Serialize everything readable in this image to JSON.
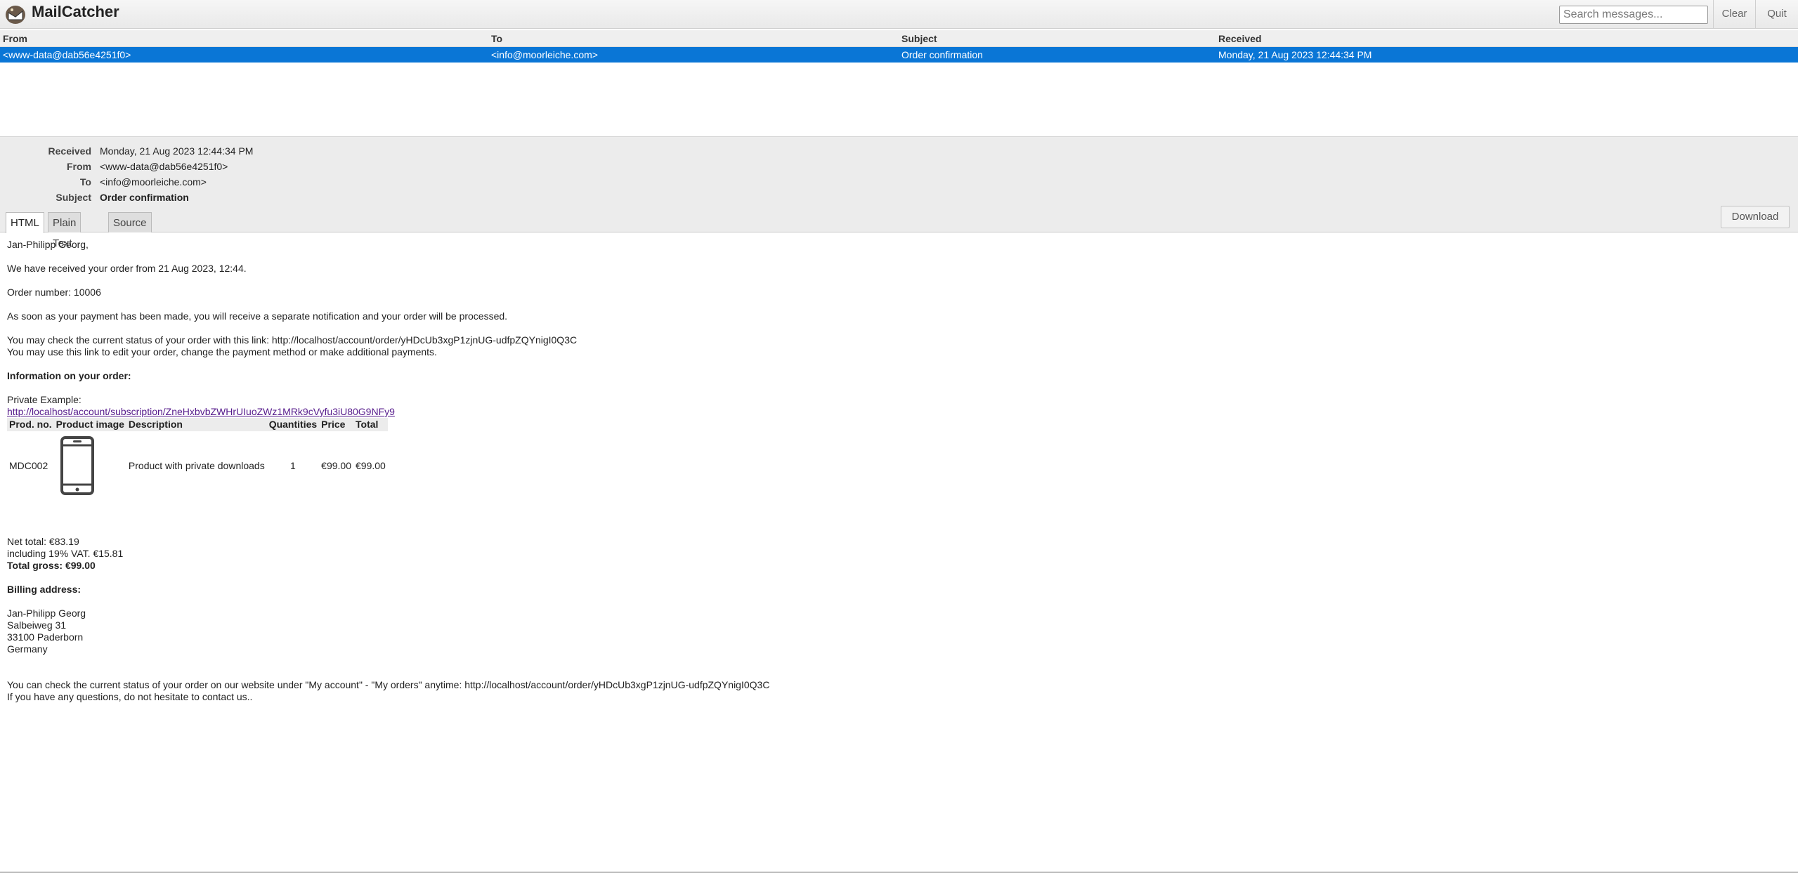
{
  "app": {
    "title": "MailCatcher",
    "search_placeholder": "Search messages...",
    "clear_label": "Clear",
    "quit_label": "Quit"
  },
  "list": {
    "columns": [
      "From",
      "To",
      "Subject",
      "Received"
    ],
    "messages": [
      {
        "from": "<www-data@dab56e4251f0>",
        "to": "<info@moorleiche.com>",
        "subject": "Order confirmation",
        "received": "Monday, 21 Aug 2023 12:44:34 PM"
      }
    ]
  },
  "meta": {
    "received_label": "Received",
    "received": "Monday, 21 Aug 2023 12:44:34 PM",
    "from_label": "From",
    "from": "<www-data@dab56e4251f0>",
    "to_label": "To",
    "to": "<info@moorleiche.com>",
    "subject_label": "Subject",
    "subject": "Order confirmation"
  },
  "tabs": [
    {
      "label": "HTML",
      "active": true
    },
    {
      "label": "Plain Text",
      "active": false
    },
    {
      "label": "Source",
      "active": false
    }
  ],
  "download_label": "Download",
  "email": {
    "greeting": "Jan-Philipp Georg,",
    "received_line": "We have received your order from 21 Aug 2023, 12:44.",
    "order_number": "Order number: 10006",
    "payment_line": "As soon as your payment has been made, you will receive a separate notification and your order will be processed.",
    "status_link_line": "You may check the current status of your order with this link: http://localhost/account/order/yHDcUb3xgP1zjnUG-udfpZQYnigI0Q3C",
    "edit_line": "You may use this link to edit your order, change the payment method or make additional payments.",
    "info_heading": "Information on your order:",
    "private_example": "Private Example:",
    "subscription_link": "http://localhost/account/subscription/ZneHxbvbZWHrUIuoZWz1MRk9cVyfu3iU80G9NFy9",
    "table": {
      "headers": [
        "Prod. no.",
        "Product image",
        "Description",
        "Quantities",
        "Price",
        "Total"
      ],
      "rows": [
        {
          "prod_no": "MDC002",
          "image_icon": "smartphone-icon",
          "description": "Product with private downloads",
          "quantity": "1",
          "price": "€99.00",
          "total": "€99.00"
        }
      ]
    },
    "net_total": "Net total: €83.19",
    "vat": "including 19% VAT. €15.81",
    "total_gross": "Total gross: €99.00",
    "billing_heading": "Billing address:",
    "billing": [
      "Jan-Philipp Georg",
      "Salbeiweg 31",
      "33100 Paderborn",
      "Germany"
    ],
    "website_line": "You can check the current status of your order on our website under \"My account\" - \"My orders\" anytime: http://localhost/account/order/yHDcUb3xgP1zjnUG-udfpZQYnigI0Q3C",
    "questions_line": "If you have any questions, do not hesitate to contact us.."
  }
}
